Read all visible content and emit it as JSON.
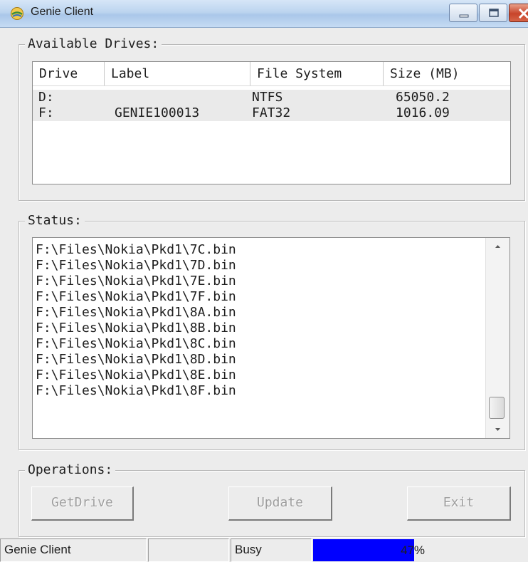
{
  "window": {
    "title": "Genie Client",
    "caption_buttons": [
      "minimize-icon",
      "maximize-icon",
      "close-icon"
    ]
  },
  "drives": {
    "group_title": "Available Drives:",
    "columns": [
      "Drive",
      "Label",
      "File System",
      "Size (MB)"
    ],
    "rows": [
      [
        "D:",
        "",
        "NTFS",
        "65050.2"
      ],
      [
        "F:",
        "GENIE100013",
        "FAT32",
        "1016.09"
      ]
    ]
  },
  "status": {
    "group_title": "Status:",
    "lines": [
      "F:\\Files\\Nokia\\Pkd1\\7C.bin",
      "F:\\Files\\Nokia\\Pkd1\\7D.bin",
      "F:\\Files\\Nokia\\Pkd1\\7E.bin",
      "F:\\Files\\Nokia\\Pkd1\\7F.bin",
      "F:\\Files\\Nokia\\Pkd1\\8A.bin",
      "F:\\Files\\Nokia\\Pkd1\\8B.bin",
      "F:\\Files\\Nokia\\Pkd1\\8C.bin",
      "F:\\Files\\Nokia\\Pkd1\\8D.bin",
      "F:\\Files\\Nokia\\Pkd1\\8E.bin",
      "F:\\Files\\Nokia\\Pkd1\\8F.bin"
    ]
  },
  "operations": {
    "group_title": "Operations:",
    "getdrive_label": "GetDrive",
    "update_label": "Update",
    "exit_label": "Exit"
  },
  "statusbar": {
    "app_name": "Genie Client",
    "blank_pane": "",
    "state": "Busy",
    "progress_text": "47%",
    "progress_fraction": 0.47
  },
  "colors": {
    "progress_fill": "#0000ff",
    "disabled_text": "#9e9e9e",
    "row_highlight": "#eaeaea"
  }
}
